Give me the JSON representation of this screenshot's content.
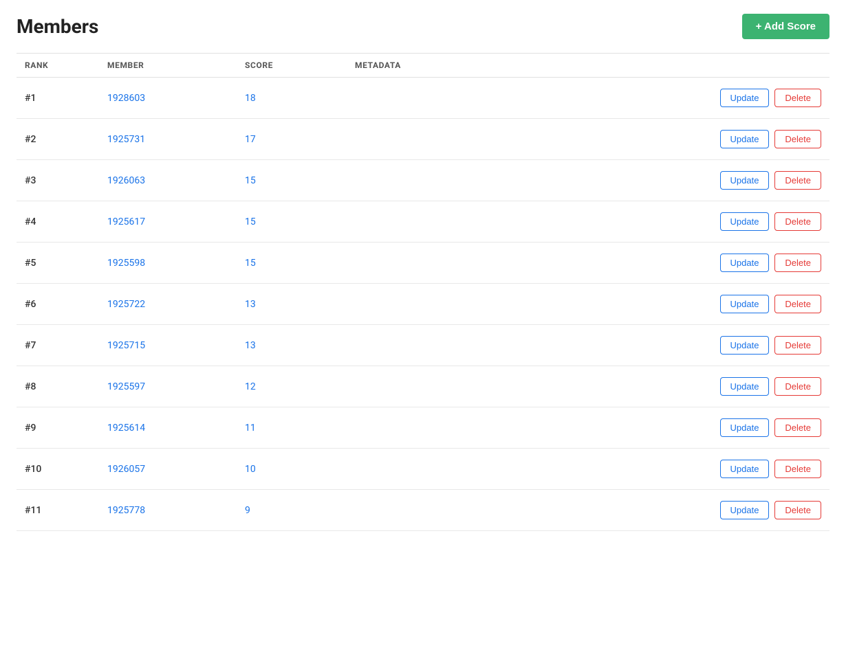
{
  "header": {
    "title": "Members",
    "add_button_label": "+ Add Score"
  },
  "table": {
    "columns": [
      {
        "key": "rank",
        "label": "RANK"
      },
      {
        "key": "member",
        "label": "MEMBER"
      },
      {
        "key": "score",
        "label": "SCORE"
      },
      {
        "key": "metadata",
        "label": "METADATA"
      },
      {
        "key": "actions",
        "label": ""
      }
    ],
    "rows": [
      {
        "rank": "#1",
        "member": "1928603",
        "score": "18",
        "metadata": ""
      },
      {
        "rank": "#2",
        "member": "1925731",
        "score": "17",
        "metadata": ""
      },
      {
        "rank": "#3",
        "member": "1926063",
        "score": "15",
        "metadata": ""
      },
      {
        "rank": "#4",
        "member": "1925617",
        "score": "15",
        "metadata": ""
      },
      {
        "rank": "#5",
        "member": "1925598",
        "score": "15",
        "metadata": ""
      },
      {
        "rank": "#6",
        "member": "1925722",
        "score": "13",
        "metadata": ""
      },
      {
        "rank": "#7",
        "member": "1925715",
        "score": "13",
        "metadata": ""
      },
      {
        "rank": "#8",
        "member": "1925597",
        "score": "12",
        "metadata": ""
      },
      {
        "rank": "#9",
        "member": "1925614",
        "score": "11",
        "metadata": ""
      },
      {
        "rank": "#10",
        "member": "1926057",
        "score": "10",
        "metadata": ""
      },
      {
        "rank": "#11",
        "member": "1925778",
        "score": "9",
        "metadata": ""
      }
    ],
    "update_label": "Update",
    "delete_label": "Delete"
  }
}
